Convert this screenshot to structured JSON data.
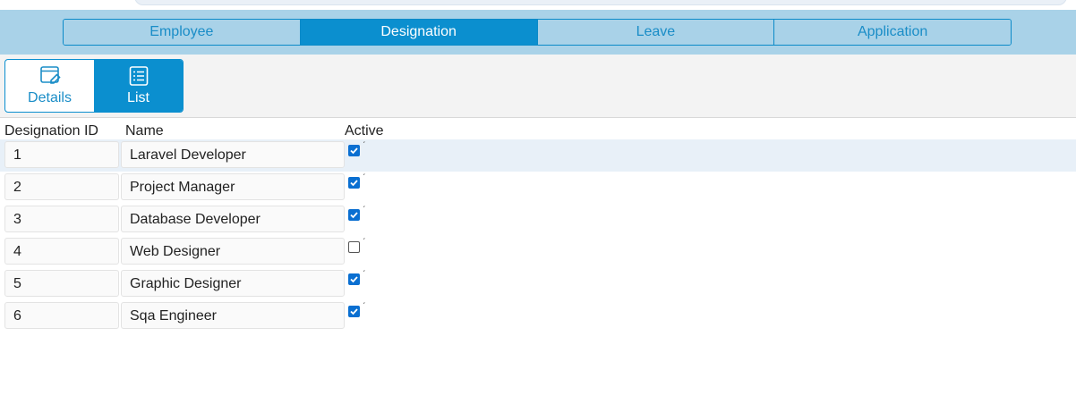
{
  "tabs": [
    {
      "label": "Employee",
      "active": false
    },
    {
      "label": "Designation",
      "active": true
    },
    {
      "label": "Leave",
      "active": false
    },
    {
      "label": "Application",
      "active": false
    }
  ],
  "view_switch": {
    "details_label": "Details",
    "list_label": "List",
    "active": "list"
  },
  "grid": {
    "columns": [
      "Designation ID",
      "Name",
      "Active"
    ],
    "rows": [
      {
        "id": "1",
        "name": "Laravel Developer",
        "active": true
      },
      {
        "id": "2",
        "name": "Project Manager",
        "active": true
      },
      {
        "id": "3",
        "name": "Database Developer",
        "active": true
      },
      {
        "id": "4",
        "name": "Web Designer",
        "active": false
      },
      {
        "id": "5",
        "name": "Graphic Designer",
        "active": true
      },
      {
        "id": "6",
        "name": "Sqa Engineer",
        "active": true
      }
    ],
    "highlighted_row": 0
  },
  "colors": {
    "accent": "#0b8fcf",
    "tab_bar_bg": "#a9d2e8",
    "row_highlight": "#e8f0f8",
    "checkbox_checked": "#0a6fd1"
  }
}
